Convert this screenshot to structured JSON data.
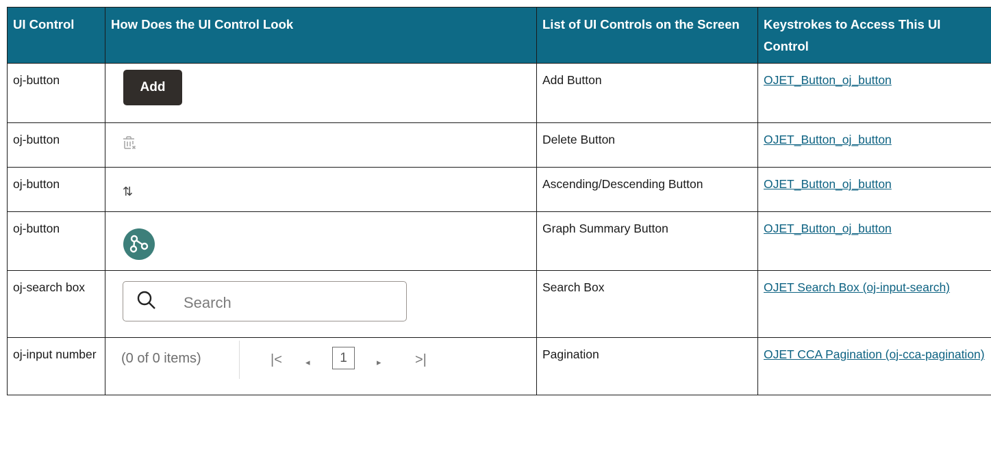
{
  "table": {
    "headers": [
      "UI Control",
      "How Does the UI Control Look",
      "List of UI Controls on the Screen",
      "Keystrokes to Access This UI Control"
    ],
    "rows": [
      {
        "control": "oj-button",
        "visual": {
          "type": "button",
          "label": "Add"
        },
        "name": "Add Button",
        "link": "OJET_Button_oj_button"
      },
      {
        "control": "oj-button",
        "visual": {
          "type": "icon",
          "icon": "trash-icon"
        },
        "name": "Delete Button",
        "link": "OJET_Button_oj_button"
      },
      {
        "control": "oj-button",
        "visual": {
          "type": "icon",
          "icon": "sort-arrows-icon",
          "glyph": "⇅"
        },
        "name": "Ascending/Descending Button",
        "link": "OJET_Button_oj_button"
      },
      {
        "control": "oj-button",
        "visual": {
          "type": "icon",
          "icon": "graph-summary-icon"
        },
        "name": "Graph Summary Button",
        "link": "OJET_Button_oj_button"
      },
      {
        "control": "oj-search box",
        "visual": {
          "type": "search",
          "placeholder": "Search"
        },
        "name": "Search Box",
        "link": "OJET Search Box (oj-input-search)"
      },
      {
        "control": "oj-input number",
        "visual": {
          "type": "pagination",
          "info": "(0 of 0 items)",
          "current_page": "1",
          "first_glyph": "|<",
          "prev_glyph": "◂",
          "next_glyph": "▸",
          "last_glyph": ">|"
        },
        "name": "Pagination",
        "link": "OJET CCA Pagination (oj-cca-pagination)"
      }
    ]
  },
  "colors": {
    "header_bg": "#0e6a86",
    "header_text": "#ffffff",
    "link": "#0d6282",
    "add_button_bg": "#312d2a",
    "graph_button_bg": "#3d7f7a"
  }
}
